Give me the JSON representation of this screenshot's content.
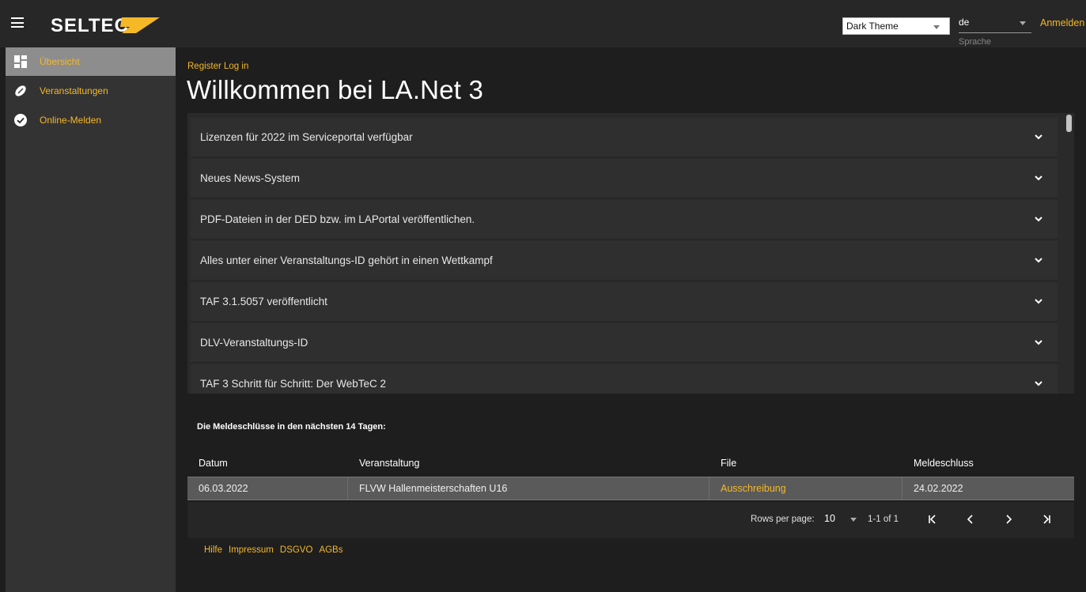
{
  "header": {
    "brand": "SELTEC",
    "theme_select": {
      "value": "Dark Theme"
    },
    "language": {
      "value": "de",
      "label": "Sprache"
    },
    "login_link": "Anmelden"
  },
  "sidebar": {
    "items": [
      {
        "label": "Übersicht",
        "icon": "dashboard-icon",
        "active": true
      },
      {
        "label": "Veranstaltungen",
        "icon": "football-icon",
        "active": false
      },
      {
        "label": "Online-Melden",
        "icon": "check-circle-icon",
        "active": false
      }
    ]
  },
  "main": {
    "breadcrumb": "Register Log in",
    "title": "Willkommen bei LA.Net 3",
    "news": [
      "Lizenzen für 2022 im Serviceportal verfügbar",
      "Neues News-System",
      "PDF-Dateien in der DED bzw. im LAPortal veröffentlichen.",
      "Alles unter einer Veranstaltungs-ID gehört in einen Wettkampf",
      "TAF 3.1.5057 veröffentlicht",
      "DLV-Veranstaltungs-ID",
      "TAF 3 Schritt für Schritt: Der WebTeC 2"
    ],
    "deadlines": {
      "heading": "Die Meldeschlüsse in den nächsten 14 Tagen:",
      "columns": [
        "Datum",
        "Veranstaltung",
        "File",
        "Meldeschluss"
      ],
      "rows": [
        {
          "datum": "06.03.2022",
          "veranstaltung": "FLVW Hallenmeisterschaften U16",
          "file": "Ausschreibung",
          "meldeschluss": "24.02.2022"
        }
      ],
      "pagination": {
        "rows_per_page_label": "Rows per page:",
        "rows_per_page": "10",
        "range": "1-1 of 1"
      }
    }
  },
  "footer": {
    "links": [
      "Hilfe",
      "Impressum",
      "DSGVO",
      "AGBs"
    ]
  },
  "colors": {
    "accent": "#f5b827",
    "background": "#1e1e1e",
    "sidebar": "#333333"
  }
}
